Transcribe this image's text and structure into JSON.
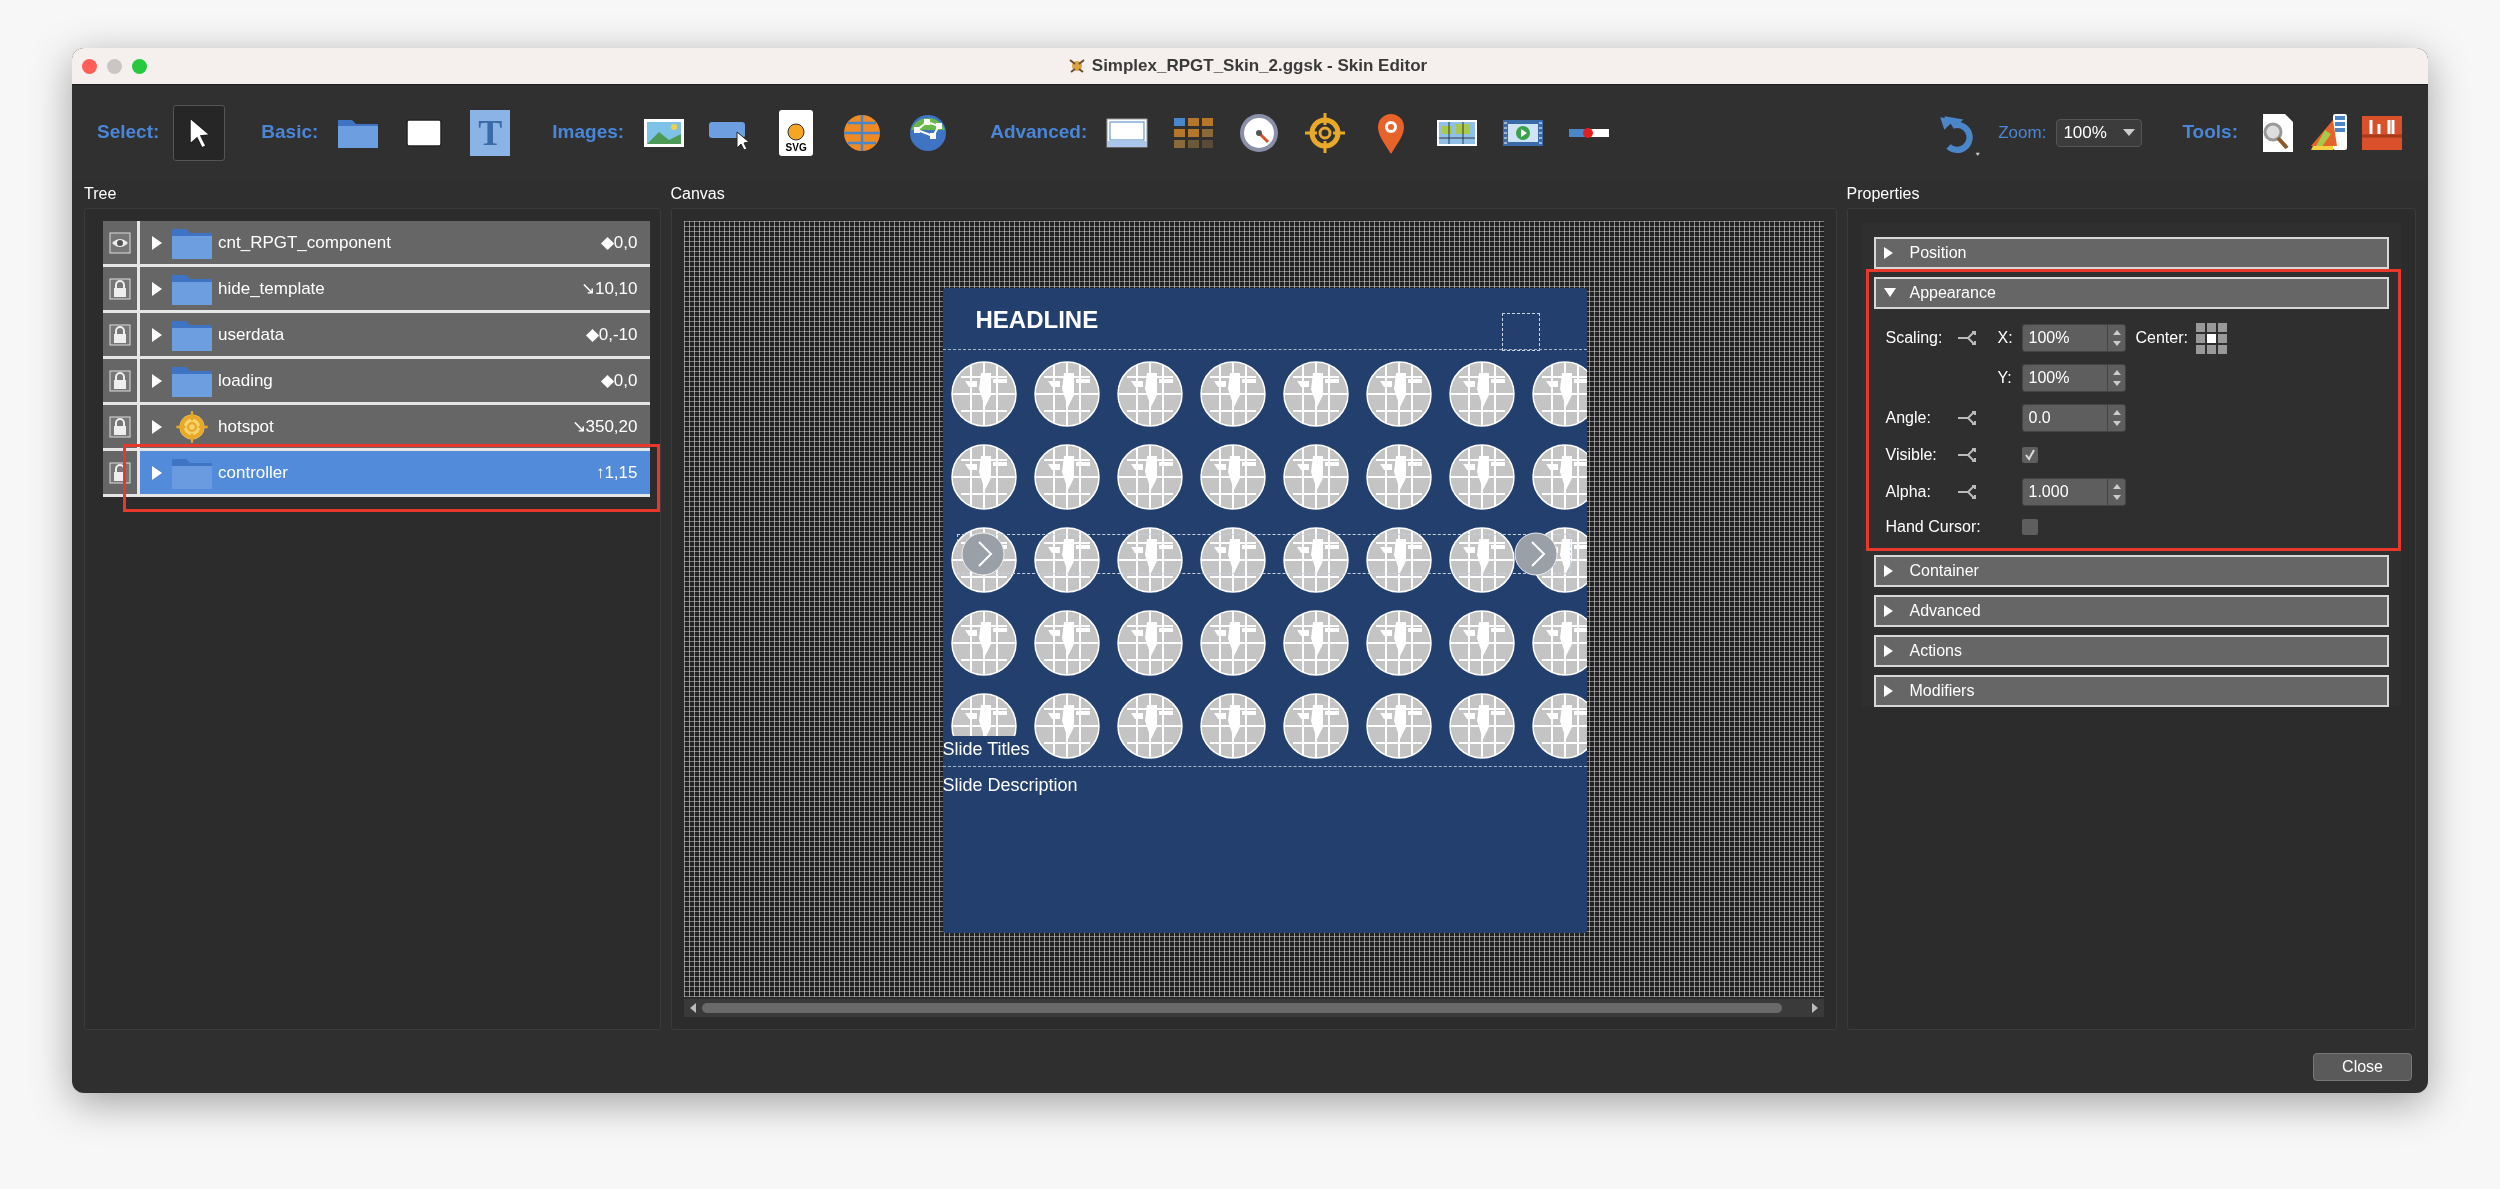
{
  "window": {
    "title": "Simplex_RPGT_Skin_2.ggsk - Skin Editor"
  },
  "toolbar": {
    "groups": [
      {
        "label": "Select:",
        "tools": [
          {
            "kind": "pointer",
            "selected": true
          }
        ]
      },
      {
        "label": "Basic:",
        "tools": [
          {
            "kind": "folder",
            "selected": false
          },
          {
            "kind": "rectangle",
            "selected": false
          },
          {
            "kind": "text",
            "glyph": "T",
            "selected": false
          }
        ]
      },
      {
        "label": "Images:",
        "tools": [
          {
            "kind": "image",
            "selected": false
          },
          {
            "kind": "button",
            "selected": false
          },
          {
            "kind": "svg",
            "glyph": "SVG",
            "selected": false
          },
          {
            "kind": "globe",
            "selected": false
          },
          {
            "kind": "network",
            "selected": false
          }
        ]
      },
      {
        "label": "Advanced:",
        "tools": [
          {
            "kind": "window",
            "selected": false
          },
          {
            "kind": "grid",
            "selected": false
          },
          {
            "kind": "gauge",
            "selected": false
          },
          {
            "kind": "crosshair",
            "selected": false
          },
          {
            "kind": "pin",
            "selected": false
          },
          {
            "kind": "map",
            "selected": false
          },
          {
            "kind": "video",
            "selected": false
          },
          {
            "kind": "slider",
            "selected": false
          }
        ]
      }
    ],
    "zoom": {
      "label": "Zoom:",
      "value": "100%"
    },
    "tools_label": "Tools:"
  },
  "tree": {
    "title": "Tree",
    "items": [
      {
        "locked": false,
        "kind": "folder",
        "name": "cnt_RPGT_component",
        "position": "◆0,0",
        "selected": false,
        "outlined": false
      },
      {
        "locked": true,
        "kind": "folder",
        "name": "hide_template",
        "position": "↘10,10",
        "selected": false,
        "outlined": false
      },
      {
        "locked": true,
        "kind": "folder",
        "name": "userdata",
        "position": "◆0,-10",
        "selected": false,
        "outlined": false
      },
      {
        "locked": true,
        "kind": "folder",
        "name": "loading",
        "position": "◆0,0",
        "selected": false,
        "outlined": false
      },
      {
        "locked": true,
        "kind": "hotspot",
        "name": "hotspot",
        "position": "↘350,20",
        "selected": false,
        "outlined": false
      },
      {
        "locked": true,
        "kind": "folder",
        "name": "controller",
        "position": "↑1,15",
        "selected": true,
        "outlined": true
      }
    ]
  },
  "canvas": {
    "title": "Canvas",
    "headline": "HEADLINE",
    "slide_title": "Slide Titles",
    "slide_description": "Slide Description"
  },
  "properties": {
    "title": "Properties",
    "sections": [
      {
        "title": "Position",
        "expanded": false,
        "outlined": false
      },
      {
        "title": "Appearance",
        "expanded": true,
        "outlined": true,
        "fields": {
          "scaling_label": "Scaling:",
          "x_label": "X:",
          "x_value": "100%",
          "center_label": "Center:",
          "y_label": "Y:",
          "y_value": "100%",
          "angle_label": "Angle:",
          "angle_value": "0.0",
          "visible_label": "Visible:",
          "visible": true,
          "alpha_label": "Alpha:",
          "alpha_value": "1.000",
          "hand_cursor_label": "Hand Cursor:",
          "hand_cursor": false
        }
      },
      {
        "title": "Container",
        "expanded": false,
        "outlined": false
      },
      {
        "title": "Advanced",
        "expanded": false,
        "outlined": false
      },
      {
        "title": "Actions",
        "expanded": false,
        "outlined": false
      },
      {
        "title": "Modifiers",
        "expanded": false,
        "outlined": false
      }
    ]
  },
  "buttons": [
    "Close"
  ]
}
